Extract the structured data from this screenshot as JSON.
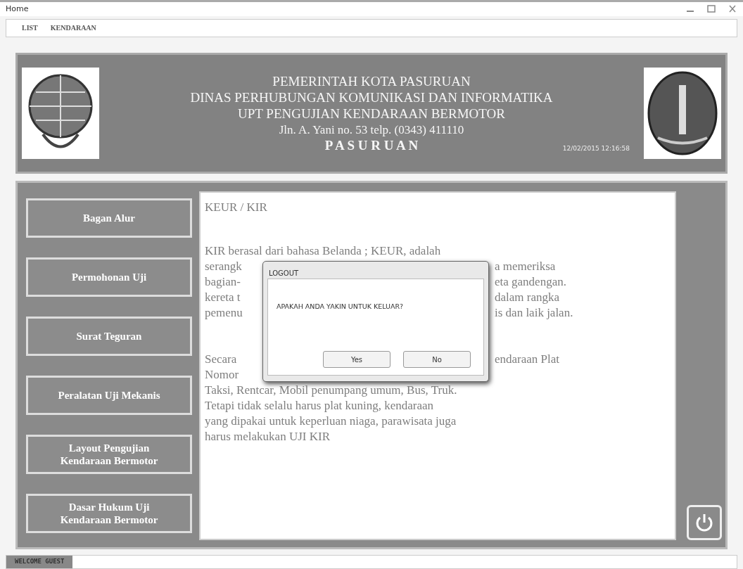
{
  "window": {
    "title": "Home"
  },
  "menu": [
    "LIST",
    "KENDARAAN"
  ],
  "header": {
    "lines": [
      "PEMERINTAH KOTA PASURUAN",
      "DINAS PERHUBUNGAN KOMUNIKASI DAN INFORMATIKA",
      "UPT PENGUJIAN KENDARAAN BERMOTOR",
      "Jln. A. Yani no. 53 telp. (0343) 411110"
    ],
    "city": "P A S U R U A N",
    "datetime": "12/02/2015 12:16:58"
  },
  "sidebar": {
    "items": [
      {
        "label": "Bagan Alur"
      },
      {
        "label": "Permohonan Uji"
      },
      {
        "label": "Surat Teguran"
      },
      {
        "label": "Peralatan Uji Mekanis"
      },
      {
        "label": "Layout Pengujian Kendaraan Bermotor"
      },
      {
        "label": "Dasar Hukum Uji Kendaraan Bermotor"
      }
    ]
  },
  "content": {
    "title": "KEUR / KIR",
    "paragraphs": [
      [
        {
          "left": "KIR berasal dari bahasa Belanda ; KEUR, adalah"
        },
        {
          "left": "serangk",
          "right": "a memeriksa"
        },
        {
          "left": "bagian-",
          "right": "eta gandengan."
        },
        {
          "left": "kereta t",
          "right": "dalam rangka"
        },
        {
          "left": "pemenu",
          "right": "is dan laik jalan."
        }
      ],
      [
        {
          "left": "Secara",
          "right": "endaraan Plat"
        },
        {
          "left": "Nomor"
        },
        {
          "left": "Taksi, Rentcar, Mobil penumpang umum, Bus, Truk."
        },
        {
          "left": "Tetapi tidak selalu harus plat kuning, kendaraan"
        },
        {
          "left": "yang dipakai untuk keperluan niaga, parawisata juga"
        },
        {
          "left": "harus melakukan UJI KIR"
        }
      ]
    ]
  },
  "dialog": {
    "title": "LOGOUT",
    "message": "APAKAH ANDA YAKIN UNTUK KELUAR?",
    "buttons": [
      "Yes",
      "No"
    ]
  },
  "status_bar": {
    "text": "WELCOME GUEST"
  }
}
